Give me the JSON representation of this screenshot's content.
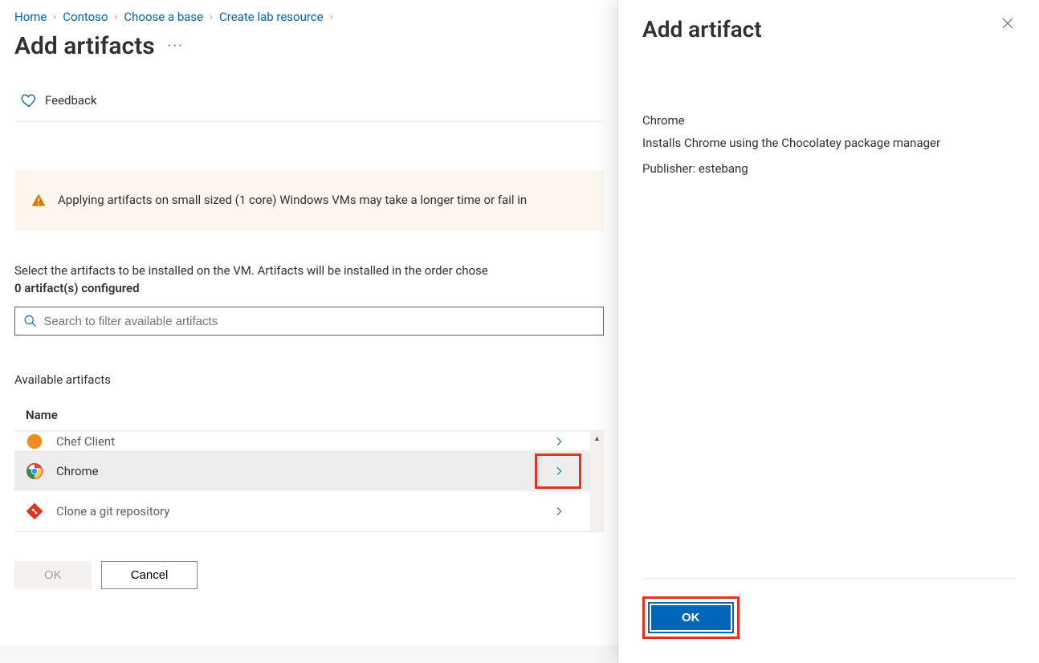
{
  "breadcrumb": {
    "items": [
      "Home",
      "Contoso",
      "Choose a base",
      "Create lab resource"
    ]
  },
  "page": {
    "title": "Add artifacts",
    "feedback": "Feedback",
    "warning": "Applying artifacts on small sized (1 core) Windows VMs may take a longer time or fail in",
    "instruction": "Select the artifacts to be installed on the VM. Artifacts will be installed in the order chose",
    "configured": "0 artifact(s) configured",
    "searchPlaceholder": "Search to filter available artifacts",
    "availableLabel": "Available artifacts",
    "nameHeader": "Name"
  },
  "artifacts": {
    "items": [
      {
        "label": "Chef Client"
      },
      {
        "label": "Chrome"
      },
      {
        "label": "Clone a git repository"
      }
    ]
  },
  "footer": {
    "ok": "OK",
    "cancel": "Cancel"
  },
  "panel": {
    "title": "Add artifact",
    "name": "Chrome",
    "description": "Installs Chrome using the Chocolatey package manager",
    "publisher": "Publisher: estebang",
    "ok": "OK"
  }
}
